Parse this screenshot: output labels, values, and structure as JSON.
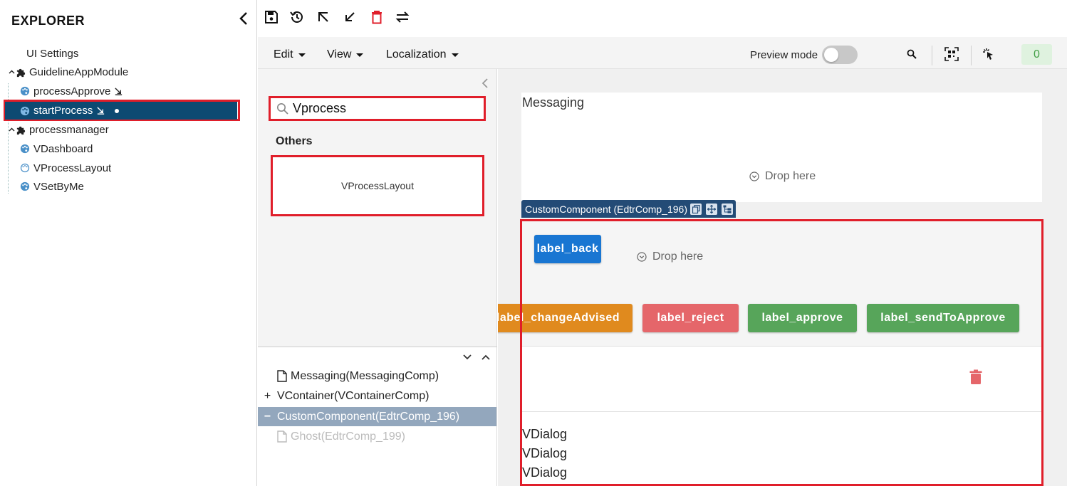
{
  "explorer": {
    "title": "EXPLORER",
    "items": [
      {
        "label": "UI Settings"
      },
      {
        "label": "GuidelineAppModule"
      },
      {
        "label": "processApprove"
      },
      {
        "label": "startProcess"
      },
      {
        "label": "processmanager"
      },
      {
        "label": "VDashboard"
      },
      {
        "label": "VProcessLayout"
      },
      {
        "label": "VSetByMe"
      }
    ]
  },
  "menubar": {
    "edit": "Edit",
    "view": "View",
    "localization": "Localization",
    "preview_label": "Preview mode",
    "counter": "0"
  },
  "palette": {
    "search_value": "Vprocess",
    "section_title": "Others",
    "component": "VProcessLayout"
  },
  "structure": {
    "rows": [
      {
        "prefix": "",
        "label": "Messaging(MessagingComp)"
      },
      {
        "prefix": "+",
        "label": "VContainer(VContainerComp)"
      },
      {
        "prefix": "−",
        "label": "CustomComponent(EdtrComp_196)"
      },
      {
        "prefix": "",
        "label": "Ghost(EdtrComp_199)"
      }
    ]
  },
  "canvas": {
    "messaging_label": "Messaging",
    "drop_here": "Drop here",
    "custom_tag": "CustomComponent (EdtrComp_196)",
    "buttons": {
      "back": "label_back",
      "change": "label_changeAdvised",
      "reject": "label_reject",
      "approve": "label_approve",
      "send": "label_sendToApprove"
    },
    "dialogs": [
      "VDialog",
      "VDialog",
      "VDialog"
    ]
  },
  "colors": {
    "selected_row": "#0d4a72",
    "highlight": "#e01e2a",
    "primary_button": "#1976d2",
    "warning_button": "#e08a1e",
    "danger_button": "#e5666a",
    "success_button": "#57a55a",
    "tag_background": "#234b76"
  }
}
